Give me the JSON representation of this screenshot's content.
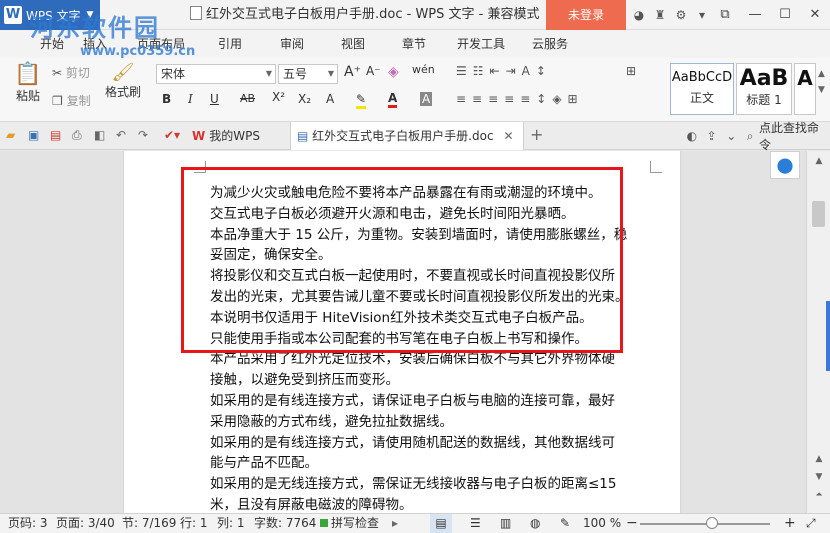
{
  "titlebar": {
    "app_name": "WPS 文字",
    "doc_title": "红外交互式电子白板用户手册.doc - WPS 文字 - 兼容模式",
    "login": "未登录",
    "icons": [
      "skin-icon",
      "shirt-icon",
      "settings-icon",
      "dropdown-icon"
    ],
    "controls": [
      "restore-icon",
      "minimize-icon",
      "maximize-icon",
      "close-icon"
    ]
  },
  "watermark": {
    "text": "河东软件园",
    "url": "www.pc0359.cn"
  },
  "menu": {
    "tabs": [
      "开始",
      "插入",
      "页面布局",
      "引用",
      "审阅",
      "视图",
      "章节",
      "开发工具",
      "云服务"
    ]
  },
  "ribbon": {
    "paste": "粘贴",
    "cut": "剪切",
    "copy": "复制",
    "format_painter": "格式刷",
    "font_name": "宋体",
    "font_size": "五号",
    "styles": [
      {
        "sample": "AaBbCcD",
        "name": "正文"
      },
      {
        "sample": "AaB",
        "name": "标题 1"
      },
      {
        "sample": "A",
        "name": ""
      }
    ]
  },
  "doctabs": {
    "tabs": [
      {
        "label": "我的WPS"
      },
      {
        "label": "红外交互式电子白板用户手册.doc"
      }
    ],
    "add": "+",
    "find_cmd": "点此查找命令"
  },
  "document": {
    "lines": [
      "为减少火灾或触电危险不要将本产品暴露在有雨或潮湿的环境中。",
      "交互式电子白板必须避开火源和电击，避免长时间阳光暴晒。",
      "本品净重大于 15 公斤，为重物。安装到墙面时，请使用膨胀螺丝，稳",
      "妥固定，确保安全。",
      "将投影仪和交互式白板一起使用时，不要直视或长时间直视投影仪所",
      "发出的光束，尤其要告诫儿童不要或长时间直视投影仪所发出的光束。",
      "本说明书仅适用于 HiteVision红外技术类交互式电子白板产品。",
      "只能使用手指或本公司配套的书写笔在电子白板上书写和操作。",
      "本产品采用了红外光定位技术，安装后确保白板不与其它外界物体硬",
      "接触，以避免受到挤压而变形。",
      "如采用的是有线连接方式，请保证电子白板与电脑的连接可靠，最好",
      "采用隐蔽的方式布线，避免拉扯数据线。",
      "如采用的是有线连接方式，请使用随机配送的数据线，其他数据线可",
      "能与产品不匹配。",
      "如采用的是无线连接方式，需保证无线接收器与电子白板的距离≤15",
      "米，且没有屏蔽电磁波的障碍物。"
    ]
  },
  "statusbar": {
    "page_code": "页码: 3",
    "page": "页面: 3/40",
    "section": "节: 7/169",
    "row": "行: 1",
    "col": "列: 1",
    "word_count": "字数: 7764",
    "spell_check": "拼写检查",
    "zoom": "100 %",
    "zoom_minus": "−",
    "zoom_plus": "+",
    "zoom_level": 0.55
  },
  "colors": {
    "accent": "#2f6bbd",
    "login": "#ef6b4f",
    "highlight_box": "#e8161b"
  }
}
